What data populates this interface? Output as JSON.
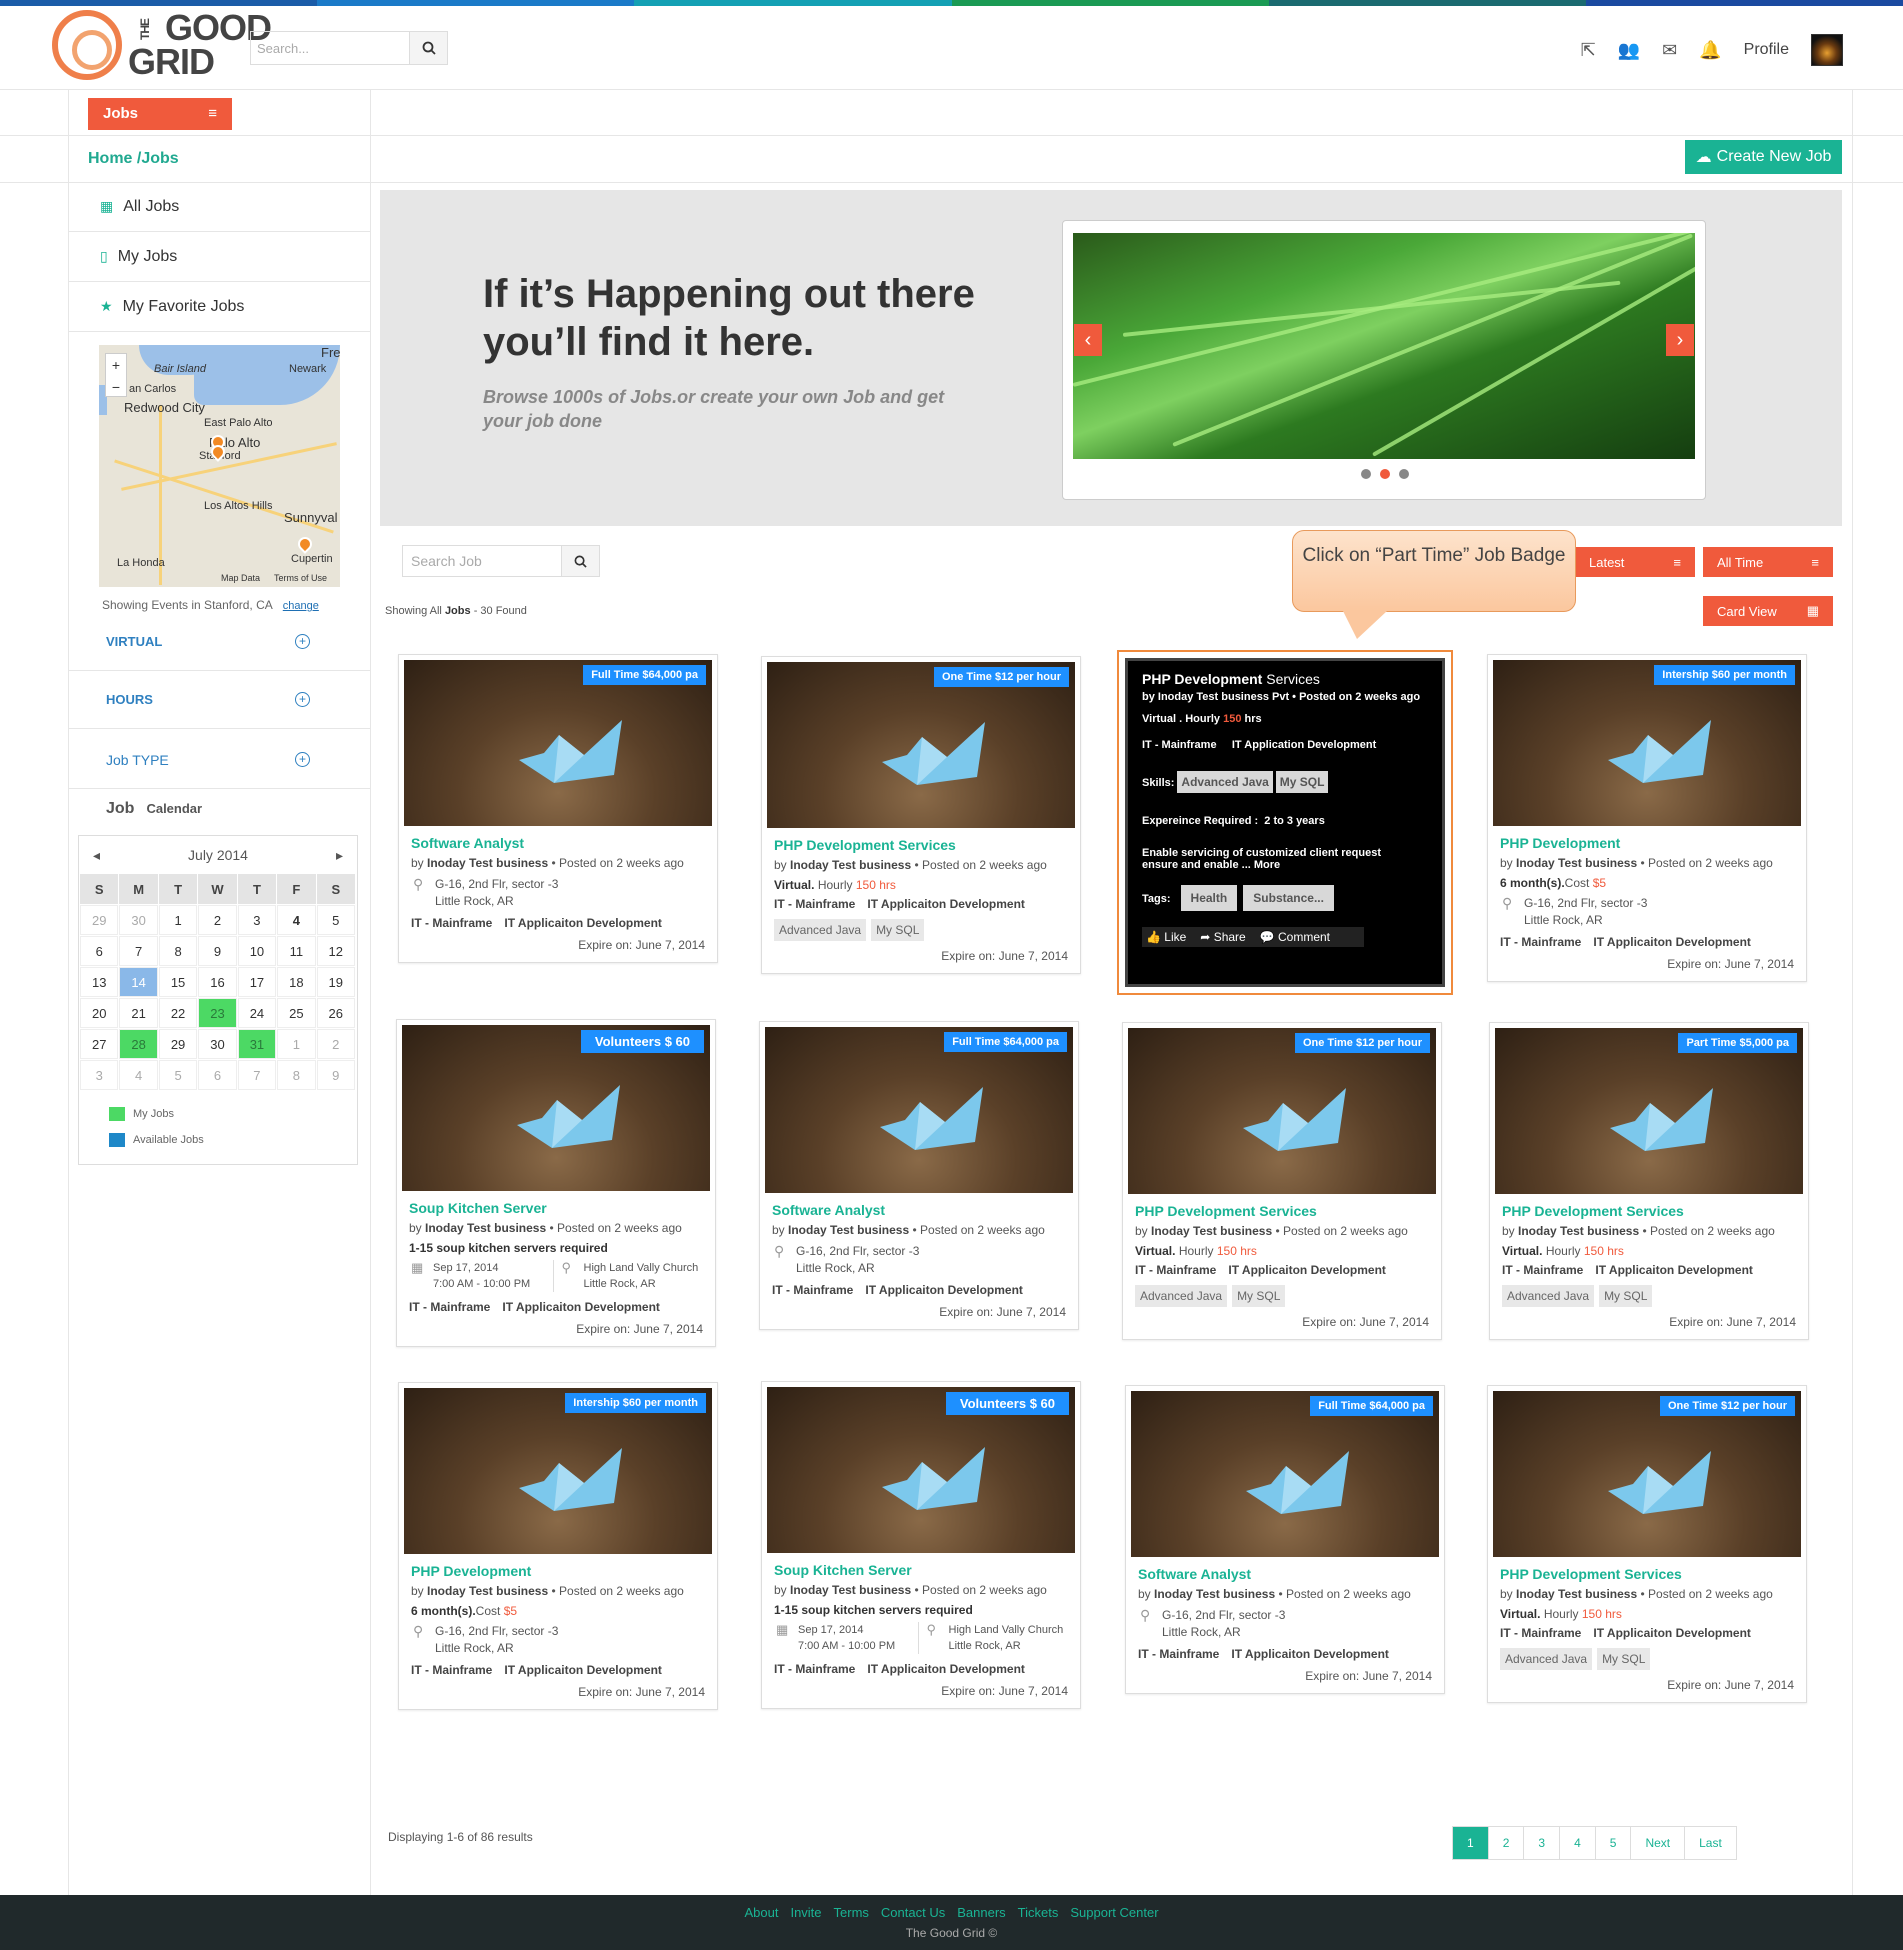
{
  "header": {
    "search_placeholder": "Search...",
    "profile_label": "Profile"
  },
  "nav": {
    "jobs_label": "Jobs",
    "breadcrumb": "Home /Jobs",
    "create_label": "Create New Job"
  },
  "sidebar": {
    "items": [
      {
        "label": "All Jobs",
        "icon": "grid-icon"
      },
      {
        "label": "My Jobs",
        "icon": "mobile-icon"
      },
      {
        "label": "My Favorite Jobs",
        "icon": "star-icon"
      }
    ],
    "map_labels": [
      "Bair Island",
      "Newark",
      "an Carlos",
      "Redwood City",
      "East Palo Alto",
      "Palo Alto",
      "Stanford",
      "Los Altos Hills",
      "Sunnyval",
      "La Honda",
      "Cupertin",
      "Map Data",
      "Terms of Use",
      "Fre"
    ],
    "events_text": "Showing Events in Stanford, CA",
    "change_label": "change",
    "filters": [
      "VIRTUAL",
      "HOURS",
      "Job TYPE"
    ],
    "jobcal_title": "Job",
    "jobcal_sub": "Calendar"
  },
  "calendar": {
    "month": "July 2014",
    "dow": [
      "S",
      "M",
      "T",
      "W",
      "T",
      "F",
      "S"
    ],
    "days": [
      "29",
      "30",
      "1",
      "2",
      "3",
      "4",
      "5",
      "6",
      "7",
      "8",
      "9",
      "10",
      "11",
      "12",
      "13",
      "14",
      "15",
      "16",
      "17",
      "18",
      "19",
      "20",
      "21",
      "22",
      "23",
      "24",
      "25",
      "26",
      "27",
      "28",
      "29",
      "30",
      "31",
      "1",
      "2",
      "3",
      "4",
      "5",
      "6",
      "7",
      "8",
      "9"
    ],
    "legend": [
      {
        "label": "My Jobs",
        "color": "#4cd964"
      },
      {
        "label": "Available Jobs",
        "color": "#1e88c8"
      }
    ]
  },
  "hero": {
    "title_line1": "If it’s Happening out there",
    "title_line2": "you’ll find it here.",
    "subtitle": "Browse 1000s of Jobs.or create your own Job and get your job done"
  },
  "toolbar": {
    "search_placeholder": "Search Job",
    "sort_label": "Latest",
    "time_label": "All Time",
    "view_label": "Card View",
    "found_prefix": "Showing All",
    "found_bold": "Jobs",
    "found_suffix": "- 30 Found"
  },
  "callout": {
    "text": "Click on “Part Time” Job Badge"
  },
  "hovercard": {
    "title": "PHP Development",
    "title2": "Services",
    "by": "by Inoday Test business Pvt •  Posted on 2 weeks ago",
    "rate_prefix": "Virtual  . Hourly",
    "rate_value": "150",
    "rate_unit": "hrs",
    "cat1": "IT - Mainframe",
    "cat2": "IT Application Development",
    "skills_label": "Skills:",
    "skill1": "Advanced Java",
    "skill2": "My SQL",
    "exp_label": "Expereince Required :",
    "exp_value": "2 to 3 years",
    "desc": "Enable servicing of customized client request ensure and enable ... More",
    "tags_label": "Tags:",
    "tag1": "Health",
    "tag2": "Substance...",
    "like": "Like",
    "share": "Share",
    "comment": "Comment"
  },
  "cards": [
    {
      "badge": "Full Time $64,000 pa",
      "title": "Software Analyst",
      "by": "Inoday Test business",
      "posted": "Posted on 2 weeks ago",
      "addr1": "G-16, 2nd Flr, sector -3",
      "addr2": "Little Rock, AR",
      "cat1": "IT - Mainframe",
      "cat2": "IT Applicaiton Development",
      "expire": "Expire on: June 7, 2014"
    },
    {
      "badge": "One Time $12 per hour",
      "title": "PHP Development Services",
      "by": "Inoday Test business",
      "posted": "Posted on 2 weeks ago",
      "rate_prefix": "Virtual.",
      "rate_mid": "Hourly",
      "rate_val": "150 hrs",
      "cat1": "IT - Mainframe",
      "cat2": "IT Applicaiton Development",
      "tag1": "Advanced Java",
      "tag2": "My SQL",
      "expire": "Expire on: June 7, 2014"
    },
    {
      "badge": "Intership $60 per month",
      "title": "PHP Development",
      "by": "Inoday Test business",
      "posted": "Posted on 2 weeks ago",
      "dur": "6 month(s).",
      "cost_label": "Cost",
      "cost": "$5",
      "addr1": "G-16, 2nd Flr, sector -3",
      "addr2": "Little Rock, AR",
      "cat1": "IT - Mainframe",
      "cat2": "IT Applicaiton Development",
      "expire": "Expire on: June 7, 2014"
    },
    {
      "badge": "Volunteers  $ 60",
      "title": "Soup Kitchen Server",
      "by": "Inoday Test business",
      "posted": "Posted on 2 weeks ago",
      "need_count": "1-15",
      "need_text": "soup kitchen servers required",
      "date1": "Sep 17, 2014",
      "date2": "7:00 AM - 10:00 PM",
      "loc1": "High Land Vally Church",
      "loc2": "Little Rock, AR",
      "cat1": "IT - Mainframe",
      "cat2": "IT Applicaiton Development",
      "expire": "Expire on: June 7, 2014"
    },
    {
      "badge": "Full Time $64,000 pa",
      "title": "Software Analyst",
      "by": "Inoday Test business",
      "posted": "Posted on 2 weeks ago",
      "addr1": "G-16, 2nd Flr, sector -3",
      "addr2": "Little Rock, AR",
      "cat1": "IT - Mainframe",
      "cat2": "IT Applicaiton Development",
      "expire": "Expire on: June 7, 2014"
    },
    {
      "badge": "One Time $12 per hour",
      "title": "PHP Development Services",
      "by": "Inoday Test business",
      "posted": "Posted on 2 weeks ago",
      "rate_prefix": "Virtual.",
      "rate_mid": "Hourly",
      "rate_val": "150 hrs",
      "cat1": "IT - Mainframe",
      "cat2": "IT Applicaiton Development",
      "tag1": "Advanced Java",
      "tag2": "My SQL",
      "expire": "Expire on: June 7, 2014"
    },
    {
      "badge": "Part Time $5,000 pa",
      "title": "PHP Development Services",
      "by": "Inoday Test business",
      "posted": "Posted on 2 weeks ago",
      "rate_prefix": "Virtual.",
      "rate_mid": "Hourly",
      "rate_val": "150 hrs",
      "cat1": "IT - Mainframe",
      "cat2": "IT Applicaiton Development",
      "tag1": "Advanced Java",
      "tag2": "My SQL",
      "expire": "Expire on: June 7, 2014"
    },
    {
      "badge": "Intership $60 per month",
      "title": "PHP Development",
      "by": "Inoday Test business",
      "posted": "Posted on 2 weeks ago",
      "dur": "6 month(s).",
      "cost_label": "Cost",
      "cost": "$5",
      "addr1": "G-16, 2nd Flr, sector -3",
      "addr2": "Little Rock, AR",
      "cat1": "IT - Mainframe",
      "cat2": "IT Applicaiton Development",
      "expire": "Expire on: June 7, 2014"
    },
    {
      "badge": "Volunteers  $ 60",
      "title": "Soup Kitchen Server",
      "by": "Inoday Test business",
      "posted": "Posted on 2 weeks ago",
      "need_count": "1-15",
      "need_text": "soup kitchen servers required",
      "date1": "Sep 17, 2014",
      "date2": "7:00 AM - 10:00 PM",
      "loc1": "High Land Vally Church",
      "loc2": "Little Rock, AR",
      "cat1": "IT - Mainframe",
      "cat2": "IT Applicaiton Development",
      "expire": "Expire on: June 7, 2014"
    },
    {
      "badge": "Full Time $64,000 pa",
      "title": "Software Analyst",
      "by": "Inoday Test business",
      "posted": "Posted on 2 weeks ago",
      "addr1": "G-16, 2nd Flr, sector -3",
      "addr2": "Little Rock, AR",
      "cat1": "IT - Mainframe",
      "cat2": "IT Applicaiton Development",
      "expire": "Expire on: June 7, 2014"
    },
    {
      "badge": "One Time $12 per hour",
      "title": "PHP Development Services",
      "by": "Inoday Test business",
      "posted": "Posted on 2 weeks ago",
      "rate_prefix": "Virtual.",
      "rate_mid": "Hourly",
      "rate_val": "150 hrs",
      "cat1": "IT - Mainframe",
      "cat2": "IT Applicaiton Development",
      "tag1": "Advanced Java",
      "tag2": "My SQL",
      "expire": "Expire on: June 7, 2014"
    }
  ],
  "pagination": {
    "summary": "Displaying 1-6 of 86 results",
    "pages": [
      "1",
      "2",
      "3",
      "4",
      "5",
      "Next",
      "Last"
    ]
  },
  "footer": {
    "links": [
      "About",
      "Invite",
      "Terms",
      "Contact Us",
      "Banners",
      "Tickets",
      "Support Center"
    ],
    "copy": "The Good Grid ©"
  },
  "colors": {
    "accent": "#1ab394",
    "orange": "#f05a3c",
    "badge": "#1e90ff"
  }
}
